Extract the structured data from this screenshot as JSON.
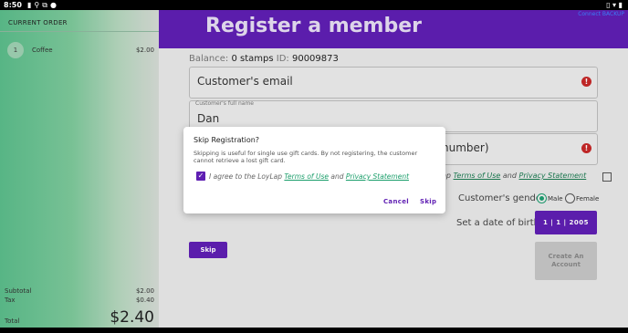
{
  "status_bar": {
    "time": "8:50",
    "icons": [
      "signal-icon",
      "usb-icon",
      "network-icon",
      "sync-icon"
    ],
    "right_icons": [
      "vibrate-icon",
      "wifi-icon",
      "battery-icon"
    ]
  },
  "order": {
    "header": "CURRENT ORDER",
    "items": [
      {
        "qty": "1",
        "name": "Coffee",
        "price": "$2.00"
      }
    ],
    "subtotal_label": "Subtotal",
    "subtotal_value": "$2.00",
    "tax_label": "Tax",
    "tax_value": "$0.40",
    "total_label": "Total",
    "total_value": "$2.40"
  },
  "banner": {
    "title": "Register a member",
    "corner_text": "Connect  BACKUP"
  },
  "balance": {
    "label": "Balance:",
    "value": "0 stamps",
    "id_label": "ID:",
    "id_value": "90009873"
  },
  "form": {
    "email_placeholder": "Customer's email",
    "name_label": "Customer's full name",
    "name_value": "Dan",
    "phone_placeholder_visible": "number)",
    "terms_prefix": "ap",
    "terms_link": "Terms of Use",
    "terms_and": "and",
    "privacy_link": "Privacy Statement",
    "gender_label": "Customer's gender",
    "gender_male": "Male",
    "gender_female": "Female",
    "dob_label": "Set a date of birth",
    "dob_value": "1 | 1 | 2005",
    "skip_label": "Skip",
    "create_label": "Create An Account"
  },
  "dialog": {
    "title": "Skip Registration?",
    "body": "Skipping is useful for single use gift cards. By not registering, the customer cannot retrieve a lost gift card.",
    "agree_prefix": "I agree to the LoyLap",
    "terms_link": "Terms of Use",
    "and": "and",
    "privacy_link": "Privacy Statement",
    "cancel_label": "Cancel",
    "skip_label": "Skip"
  },
  "colors": {
    "brand_purple": "#5f1fb3",
    "accent_green": "#1e9e70",
    "error_red": "#c62828"
  }
}
